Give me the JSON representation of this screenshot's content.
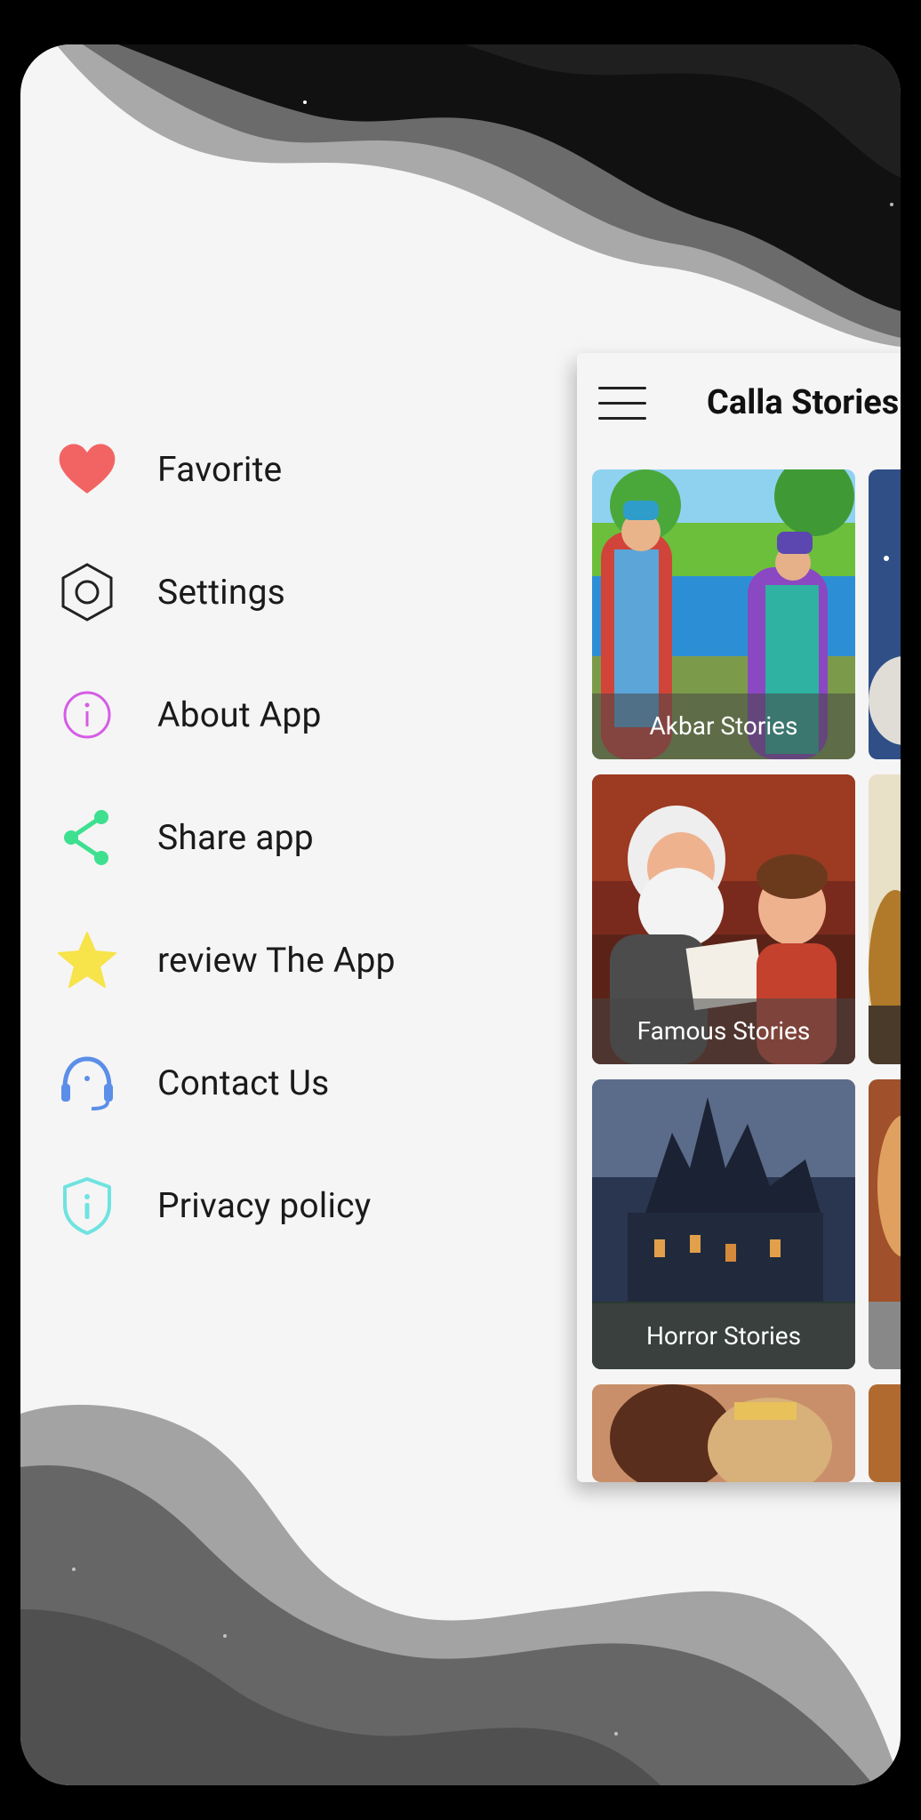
{
  "menu": {
    "items": [
      {
        "label": "Favorite",
        "icon": "heart-icon",
        "color": "#f26464"
      },
      {
        "label": "Settings",
        "icon": "settings-hexagon-icon",
        "color": "#222222"
      },
      {
        "label": "About App",
        "icon": "info-icon",
        "color": "#d65ce6"
      },
      {
        "label": "Share app",
        "icon": "share-icon",
        "color": "#3ee08f"
      },
      {
        "label": "review The App",
        "icon": "star-icon",
        "color": "#f7e34a"
      },
      {
        "label": "Contact Us",
        "icon": "headset-icon",
        "color": "#5b8ee8"
      },
      {
        "label": "Privacy policy",
        "icon": "shield-info-icon",
        "color": "#6fe3e0"
      }
    ]
  },
  "app": {
    "title": "Calla Stories",
    "cards": [
      {
        "label": "Akbar Stories"
      },
      {
        "label": "Famous Stories"
      },
      {
        "label": "Horror Stories"
      }
    ]
  }
}
